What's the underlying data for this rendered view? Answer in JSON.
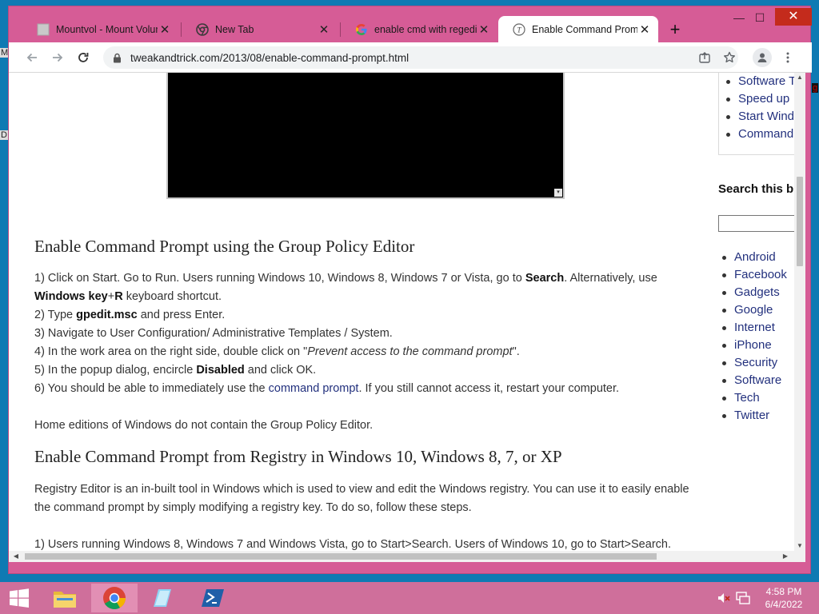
{
  "desktop": {
    "frag_m": "M",
    "frag_d": "D",
    "frag_right": "g"
  },
  "window": {
    "controls": {
      "minimize": "—",
      "maximize": "☐",
      "close": "✕"
    },
    "tabs": [
      {
        "title": "Mountvol - Mount Volume",
        "icon": "page-icon",
        "close": "✕"
      },
      {
        "title": "New Tab",
        "icon": "chrome-icon",
        "close": "✕"
      },
      {
        "title": "enable cmd with regedit",
        "icon": "google-icon",
        "close": "✕"
      },
      {
        "title": "Enable Command Prompt",
        "icon": "tweakandtrick-icon",
        "close": "✕",
        "active": true
      }
    ],
    "new_tab": "+"
  },
  "toolbar": {
    "url": "tweakandtrick.com/2013/08/enable-command-prompt.html",
    "icons": [
      "back-icon",
      "forward-icon",
      "reload-icon",
      "lock-icon",
      "share-icon",
      "star-icon",
      "profile-icon",
      "menu-icon"
    ]
  },
  "page": {
    "sections": [
      {
        "heading": "Enable Command Prompt using the Group Policy Editor",
        "lines": [
          [
            "1) Click on Start. Go to Run. Users running Windows 10, Windows 8, Windows 7 or Vista, go to ",
            "Search",
            ". Alternatively, use"
          ],
          [
            "",
            "Windows key",
            "+",
            "R",
            " keyboard shortcut."
          ],
          [
            "2) Type ",
            "gpedit.msc",
            " and press Enter."
          ],
          [
            "3) Navigate to User Configuration/ Administrative Templates / System."
          ],
          [
            "4) In the work area on the right side, double click on \"",
            "Prevent access to the command prompt",
            "\"."
          ],
          [
            "5) In the popup dialog, encircle ",
            "Disabled",
            " and click OK."
          ],
          [
            "6) You should be able to immediately use the ",
            "command prompt",
            ". If you still cannot access it, restart your computer."
          ]
        ],
        "note": "Home editions of Windows do not contain the Group Policy Editor."
      },
      {
        "heading": "Enable Command Prompt from Registry in Windows 10, Windows 8, 7, or XP",
        "intro_1": "Registry Editor is an in-built tool in Windows which is used to view and edit the Windows registry. You can use it to easily enable",
        "intro_2": "the command prompt by simply modifying a registry key. To do so, follow these steps.",
        "step_1": "1) Users running Windows 8, Windows 7 and Windows Vista, go to Start>Search. Users of Windows 10, go to Start>Search."
      }
    ]
  },
  "sidebar": {
    "related": [
      "Software T",
      "Speed up",
      "Start Wind",
      "Command"
    ],
    "search_title": "Search this b",
    "labels": [
      "Android",
      "Facebook",
      "Gadgets",
      "Google",
      "Internet",
      "iPhone",
      "Security",
      "Software",
      "Tech",
      "Twitter"
    ]
  },
  "taskbar": {
    "items": [
      "start-icon",
      "file-explorer-icon",
      "chrome-icon",
      "notepad-icon",
      "powershell-icon"
    ],
    "time": "4:58 PM",
    "date": "6/4/2022"
  }
}
